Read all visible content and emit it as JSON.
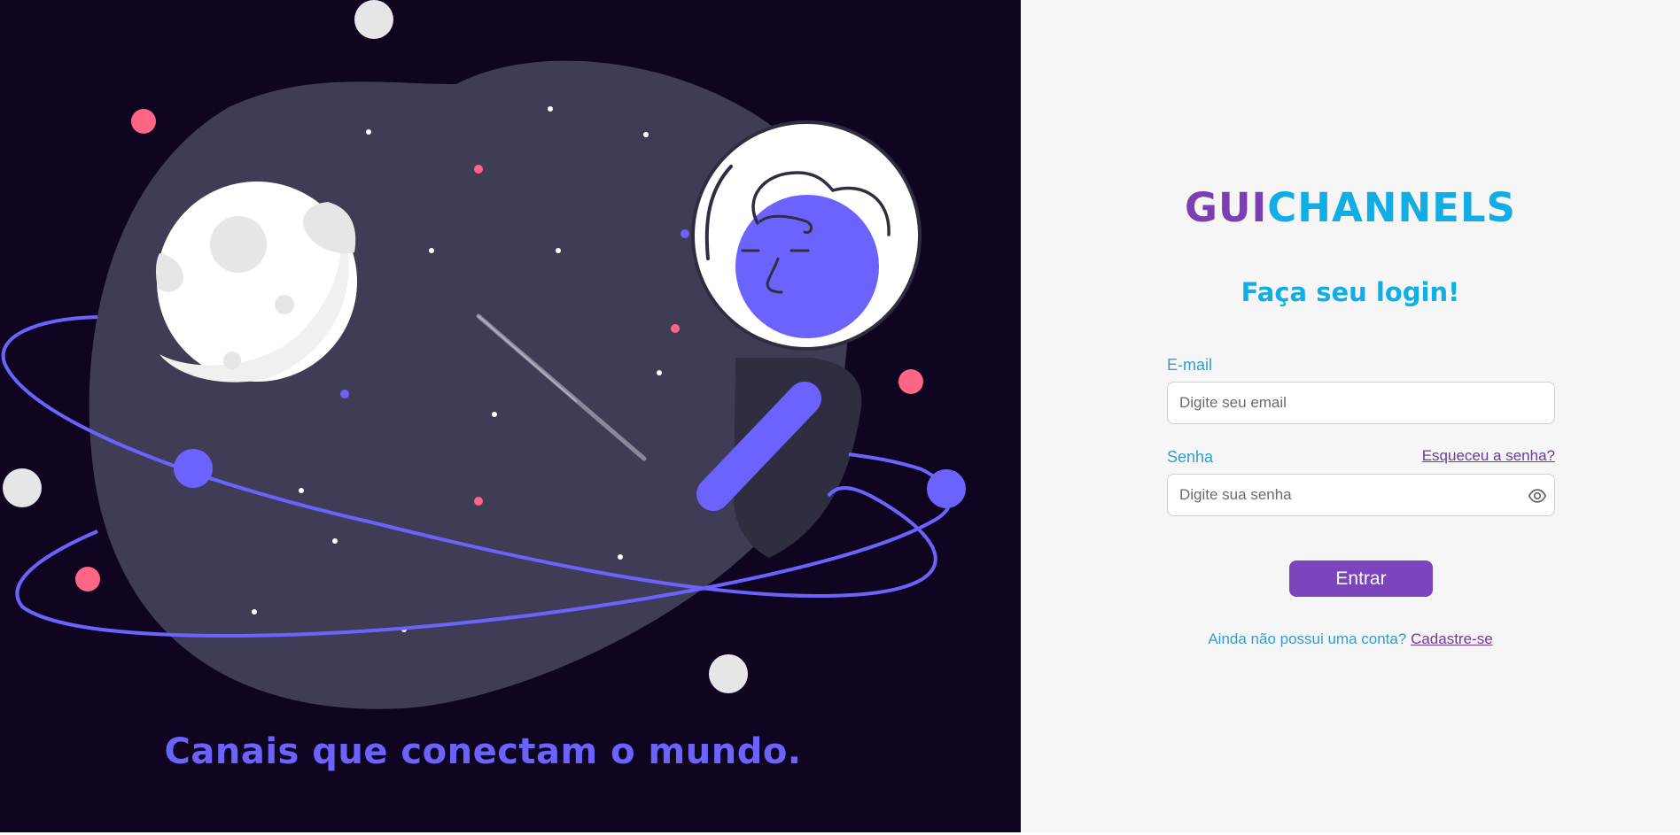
{
  "left_panel": {
    "tagline": "Canais que conectam o mundo."
  },
  "logo": {
    "part1": "GUI",
    "part2": "CHANNELS"
  },
  "login": {
    "title": "Faça seu login!",
    "email_label": "E-mail",
    "email_placeholder": "Digite seu email",
    "password_label": "Senha",
    "password_placeholder": "Digite sua senha",
    "forgot_label": "Esqueceu a senha?",
    "submit_label": "Entrar",
    "signup_prompt": "Ainda não possui uma conta?",
    "signup_link": "Cadastre-se"
  },
  "icons": {
    "password_toggle": "eye-icon"
  },
  "colors": {
    "dark_background": "#0f0520",
    "accent_purple": "#7c45be",
    "accent_blue": "#13ade5",
    "illustration_violet": "#6c63ff",
    "star_pink": "#ff6584"
  }
}
